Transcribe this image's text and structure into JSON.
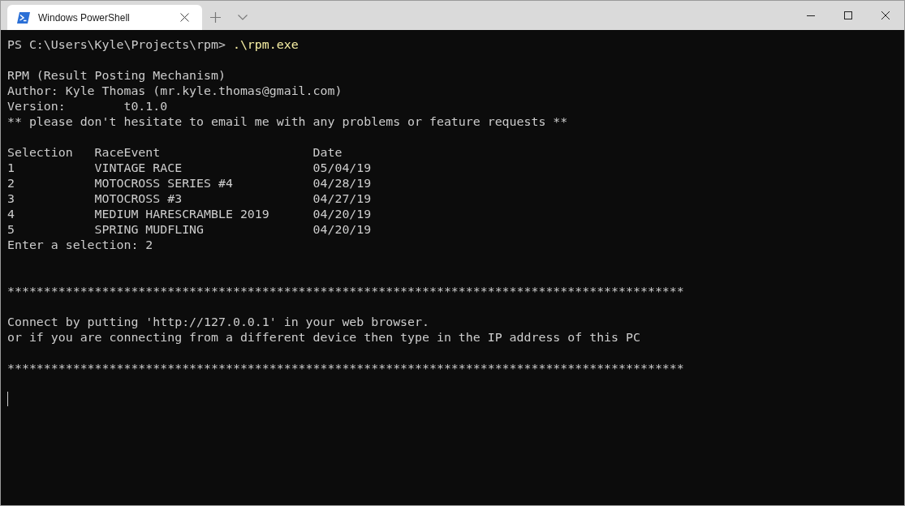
{
  "window": {
    "tabs": [
      {
        "title": "Windows PowerShell",
        "selected": true
      }
    ]
  },
  "terminal": {
    "prompt": "PS C:\\Users\\Kyle\\Projects\\rpm> ",
    "command": ".\\rpm.exe",
    "header_lines": [
      "RPM (Result Posting Mechanism)",
      "Author: Kyle Thomas (mr.kyle.thomas@gmail.com)",
      "Version:        t0.1.0",
      "** please don't hesitate to email me with any problems or feature requests **"
    ],
    "table": {
      "columns": [
        "Selection",
        "RaceEvent",
        "Date"
      ],
      "rows": [
        [
          "1",
          "VINTAGE RACE",
          "05/04/19"
        ],
        [
          "2",
          "MOTOCROSS SERIES #4",
          "04/28/19"
        ],
        [
          "3",
          "MOTOCROSS #3",
          "04/27/19"
        ],
        [
          "4",
          "MEDIUM HARESCRAMBLE 2019",
          "04/20/19"
        ],
        [
          "5",
          "SPRING MUDFLING",
          "04/20/19"
        ]
      ]
    },
    "input_line": "Enter a selection: 2",
    "banner": {
      "rule": "*********************************************************************************************",
      "lines": [
        "Connect by putting 'http://127.0.0.1' in your web browser.",
        "or if you are connecting from a different device then type in the IP address of this PC"
      ]
    }
  }
}
